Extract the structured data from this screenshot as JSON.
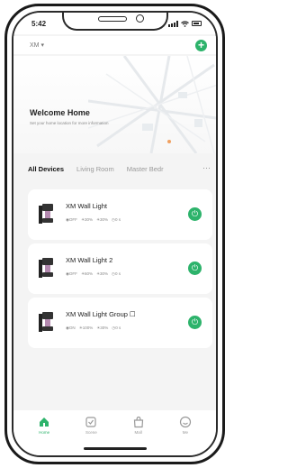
{
  "status_bar": {
    "time": "5:42"
  },
  "header": {
    "home_name": "XM ▾",
    "add_icon": "plus-circle-icon"
  },
  "welcome": {
    "title": "Welcome Home",
    "subtitle": "Set your home location for more information"
  },
  "tabs": [
    {
      "label": "All Devices",
      "active": true
    },
    {
      "label": "Living Room",
      "active": false
    },
    {
      "label": "Master Bedr",
      "active": false
    }
  ],
  "tabs_more": "···",
  "devices": [
    {
      "name": "XM Wall Light",
      "state": "◉OFF",
      "brightness": "☀30%",
      "color": "☀30%",
      "timer": "◷0 s"
    },
    {
      "name": "XM Wall Light 2",
      "state": "◉OFF",
      "brightness": "☀60%",
      "color": "☀30%",
      "timer": "◷0 s"
    },
    {
      "name": "XM Wall Light Group ☐",
      "state": "◉ON",
      "brightness": "☀100%",
      "color": "☀30%",
      "timer": "◷0 s"
    }
  ],
  "tabbar": [
    {
      "label": "Home",
      "icon": "home-icon",
      "active": true
    },
    {
      "label": "Scene",
      "icon": "scene-icon",
      "active": false
    },
    {
      "label": "Mall",
      "icon": "mall-icon",
      "active": false
    },
    {
      "label": "Me",
      "icon": "me-icon",
      "active": false
    }
  ],
  "colors": {
    "accent": "#2db36b",
    "background": "#f4f4f4",
    "card": "#ffffff"
  }
}
